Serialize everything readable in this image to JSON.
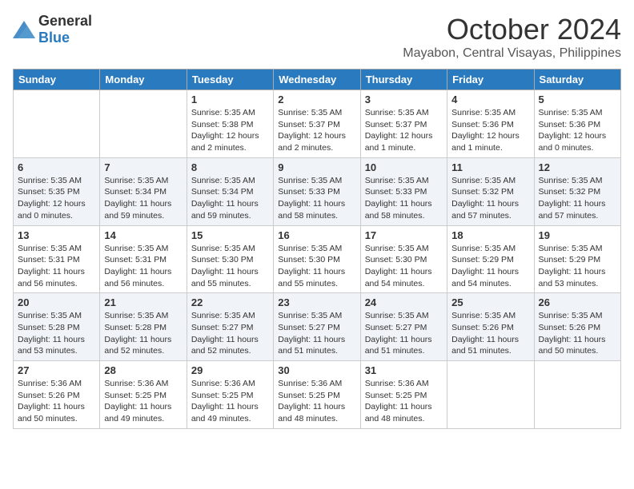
{
  "header": {
    "logo_general": "General",
    "logo_blue": "Blue",
    "month": "October 2024",
    "location": "Mayabon, Central Visayas, Philippines"
  },
  "columns": [
    "Sunday",
    "Monday",
    "Tuesday",
    "Wednesday",
    "Thursday",
    "Friday",
    "Saturday"
  ],
  "weeks": [
    [
      {
        "day": "",
        "info": ""
      },
      {
        "day": "",
        "info": ""
      },
      {
        "day": "1",
        "info": "Sunrise: 5:35 AM\nSunset: 5:38 PM\nDaylight: 12 hours and 2 minutes."
      },
      {
        "day": "2",
        "info": "Sunrise: 5:35 AM\nSunset: 5:37 PM\nDaylight: 12 hours and 2 minutes."
      },
      {
        "day": "3",
        "info": "Sunrise: 5:35 AM\nSunset: 5:37 PM\nDaylight: 12 hours and 1 minute."
      },
      {
        "day": "4",
        "info": "Sunrise: 5:35 AM\nSunset: 5:36 PM\nDaylight: 12 hours and 1 minute."
      },
      {
        "day": "5",
        "info": "Sunrise: 5:35 AM\nSunset: 5:36 PM\nDaylight: 12 hours and 0 minutes."
      }
    ],
    [
      {
        "day": "6",
        "info": "Sunrise: 5:35 AM\nSunset: 5:35 PM\nDaylight: 12 hours and 0 minutes."
      },
      {
        "day": "7",
        "info": "Sunrise: 5:35 AM\nSunset: 5:34 PM\nDaylight: 11 hours and 59 minutes."
      },
      {
        "day": "8",
        "info": "Sunrise: 5:35 AM\nSunset: 5:34 PM\nDaylight: 11 hours and 59 minutes."
      },
      {
        "day": "9",
        "info": "Sunrise: 5:35 AM\nSunset: 5:33 PM\nDaylight: 11 hours and 58 minutes."
      },
      {
        "day": "10",
        "info": "Sunrise: 5:35 AM\nSunset: 5:33 PM\nDaylight: 11 hours and 58 minutes."
      },
      {
        "day": "11",
        "info": "Sunrise: 5:35 AM\nSunset: 5:32 PM\nDaylight: 11 hours and 57 minutes."
      },
      {
        "day": "12",
        "info": "Sunrise: 5:35 AM\nSunset: 5:32 PM\nDaylight: 11 hours and 57 minutes."
      }
    ],
    [
      {
        "day": "13",
        "info": "Sunrise: 5:35 AM\nSunset: 5:31 PM\nDaylight: 11 hours and 56 minutes."
      },
      {
        "day": "14",
        "info": "Sunrise: 5:35 AM\nSunset: 5:31 PM\nDaylight: 11 hours and 56 minutes."
      },
      {
        "day": "15",
        "info": "Sunrise: 5:35 AM\nSunset: 5:30 PM\nDaylight: 11 hours and 55 minutes."
      },
      {
        "day": "16",
        "info": "Sunrise: 5:35 AM\nSunset: 5:30 PM\nDaylight: 11 hours and 55 minutes."
      },
      {
        "day": "17",
        "info": "Sunrise: 5:35 AM\nSunset: 5:30 PM\nDaylight: 11 hours and 54 minutes."
      },
      {
        "day": "18",
        "info": "Sunrise: 5:35 AM\nSunset: 5:29 PM\nDaylight: 11 hours and 54 minutes."
      },
      {
        "day": "19",
        "info": "Sunrise: 5:35 AM\nSunset: 5:29 PM\nDaylight: 11 hours and 53 minutes."
      }
    ],
    [
      {
        "day": "20",
        "info": "Sunrise: 5:35 AM\nSunset: 5:28 PM\nDaylight: 11 hours and 53 minutes."
      },
      {
        "day": "21",
        "info": "Sunrise: 5:35 AM\nSunset: 5:28 PM\nDaylight: 11 hours and 52 minutes."
      },
      {
        "day": "22",
        "info": "Sunrise: 5:35 AM\nSunset: 5:27 PM\nDaylight: 11 hours and 52 minutes."
      },
      {
        "day": "23",
        "info": "Sunrise: 5:35 AM\nSunset: 5:27 PM\nDaylight: 11 hours and 51 minutes."
      },
      {
        "day": "24",
        "info": "Sunrise: 5:35 AM\nSunset: 5:27 PM\nDaylight: 11 hours and 51 minutes."
      },
      {
        "day": "25",
        "info": "Sunrise: 5:35 AM\nSunset: 5:26 PM\nDaylight: 11 hours and 51 minutes."
      },
      {
        "day": "26",
        "info": "Sunrise: 5:35 AM\nSunset: 5:26 PM\nDaylight: 11 hours and 50 minutes."
      }
    ],
    [
      {
        "day": "27",
        "info": "Sunrise: 5:36 AM\nSunset: 5:26 PM\nDaylight: 11 hours and 50 minutes."
      },
      {
        "day": "28",
        "info": "Sunrise: 5:36 AM\nSunset: 5:25 PM\nDaylight: 11 hours and 49 minutes."
      },
      {
        "day": "29",
        "info": "Sunrise: 5:36 AM\nSunset: 5:25 PM\nDaylight: 11 hours and 49 minutes."
      },
      {
        "day": "30",
        "info": "Sunrise: 5:36 AM\nSunset: 5:25 PM\nDaylight: 11 hours and 48 minutes."
      },
      {
        "day": "31",
        "info": "Sunrise: 5:36 AM\nSunset: 5:25 PM\nDaylight: 11 hours and 48 minutes."
      },
      {
        "day": "",
        "info": ""
      },
      {
        "day": "",
        "info": ""
      }
    ]
  ]
}
